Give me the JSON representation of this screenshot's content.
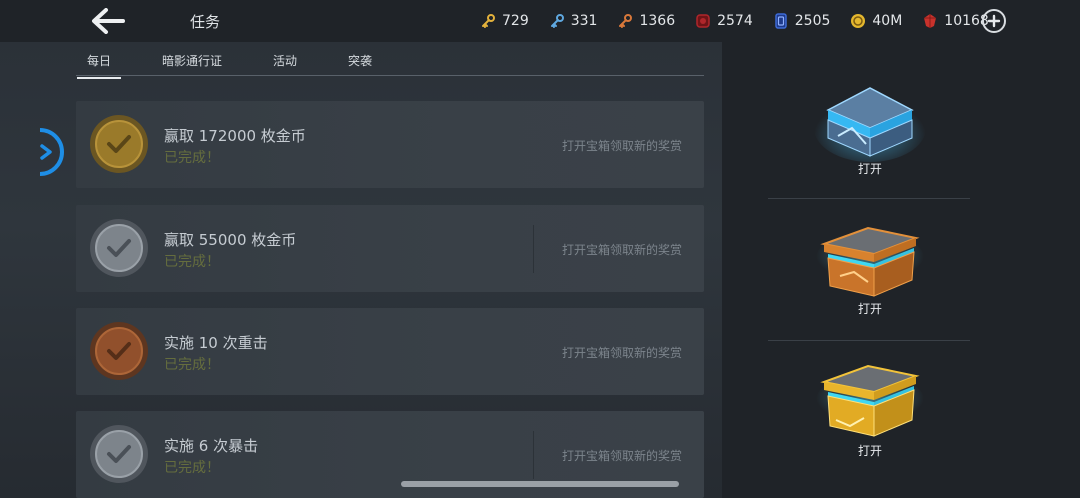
{
  "header": {
    "title": "任务",
    "currencies": [
      {
        "icon": "gold-key-icon",
        "value": "729",
        "color": "#e2b13c"
      },
      {
        "icon": "blue-key-icon",
        "value": "331",
        "color": "#5fa8e0"
      },
      {
        "icon": "bronze-key-icon",
        "value": "1366",
        "color": "#d9783a"
      },
      {
        "icon": "red-token-icon",
        "value": "2574",
        "color": "#b0262b"
      },
      {
        "icon": "blue-card-icon",
        "value": "2505",
        "color": "#3d6ad6"
      },
      {
        "icon": "gold-coin-icon",
        "value": "40M",
        "color": "#e4b72e"
      },
      {
        "icon": "red-gem-icon",
        "value": "10168",
        "color": "#c8322c"
      }
    ]
  },
  "tabs": [
    {
      "label": "每日",
      "active": true
    },
    {
      "label": "暗影通行证",
      "active": false
    },
    {
      "label": "活动",
      "active": false
    },
    {
      "label": "突袭",
      "active": false
    }
  ],
  "tasks": [
    {
      "name": "赢取 172000 枚金币",
      "status": "已完成！",
      "hint": "打开宝箱领取新的奖赏",
      "medal": "gold",
      "medal_color": "#9a7a2a"
    },
    {
      "name": "赢取 55000 枚金币",
      "status": "已完成！",
      "hint": "打开宝箱领取新的奖赏",
      "medal": "silver",
      "medal_color": "#7d848b"
    },
    {
      "name": "实施 10 次重击",
      "status": "已完成！",
      "hint": "打开宝箱领取新的奖赏",
      "medal": "bronze",
      "medal_color": "#91502c"
    },
    {
      "name": "实施 6 次暴击",
      "status": "已完成！",
      "hint": "打开宝箱领取新的奖赏",
      "medal": "silver",
      "medal_color": "#7d848b"
    }
  ],
  "chests": [
    {
      "type": "blue-chest",
      "label": "打开"
    },
    {
      "type": "bronze-chest",
      "label": "打开"
    },
    {
      "type": "gold-chest",
      "label": "打开"
    }
  ]
}
